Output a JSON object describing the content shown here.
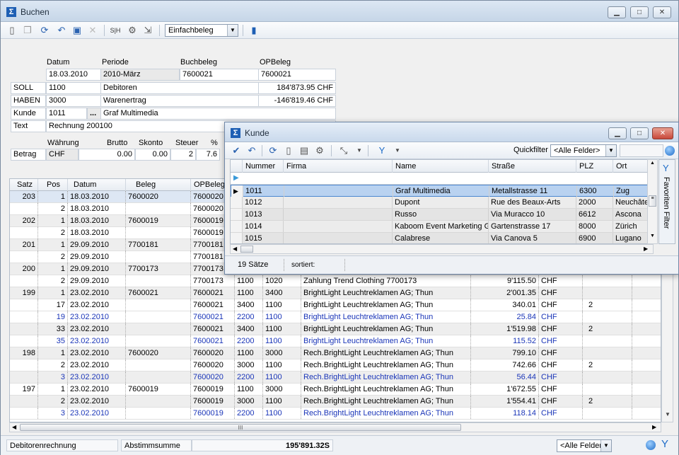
{
  "window": {
    "title": "Buchen"
  },
  "toolbar": {
    "mode_select": "Einfachbeleg"
  },
  "form": {
    "headers": {
      "datum": "Datum",
      "periode": "Periode",
      "buchbeleg": "Buchbeleg",
      "opbeleg": "OPBeleg"
    },
    "datum": "18.03.2010",
    "periode": "2010-März",
    "buchbeleg": "7600021",
    "opbeleg": "7600021",
    "soll": {
      "label": "SOLL",
      "konto": "1100",
      "name": "Debitoren",
      "saldo": "184'873.95 CHF"
    },
    "haben": {
      "label": "HABEN",
      "konto": "3000",
      "name": "Warenertrag",
      "saldo": "-146'819.46 CHF"
    },
    "kunde": {
      "label": "Kunde",
      "nummer": "1011",
      "browse": "...",
      "name": "Graf Multimedia"
    },
    "text": {
      "label": "Text",
      "value": "Rechnung 200100"
    },
    "betrag_headers": {
      "waehrung": "Währung",
      "brutto": "Brutto",
      "skonto": "Skonto",
      "steuer": "Steuer",
      "prozent": "%"
    },
    "betrag": {
      "label": "Betrag",
      "waehrung": "CHF",
      "brutto": "0.00",
      "skonto": "0.00",
      "steuer": "2",
      "prozent": "7.6"
    }
  },
  "journal": {
    "columns": [
      "Satz",
      "Pos",
      "Datum",
      "Beleg",
      "OPBeleg"
    ],
    "rows": [
      {
        "satz": "203",
        "pos": "1",
        "datum": "18.03.2010",
        "beleg": "7600020",
        "opbeleg": "7600020",
        "soll": "",
        "haben": "",
        "text": "",
        "betrag": "",
        "waehrung": "",
        "steuer": "",
        "style": "sel"
      },
      {
        "satz": "",
        "pos": "2",
        "datum": "18.03.2010",
        "beleg": "",
        "opbeleg": "7600020",
        "soll": "",
        "haben": "",
        "text": "",
        "betrag": "",
        "waehrung": "",
        "steuer": "",
        "style": "white"
      },
      {
        "satz": "202",
        "pos": "1",
        "datum": "18.03.2010",
        "beleg": "7600019",
        "opbeleg": "7600019",
        "soll": "",
        "haben": "",
        "text": "",
        "betrag": "",
        "waehrung": "",
        "steuer": "",
        "style": "alt"
      },
      {
        "satz": "",
        "pos": "2",
        "datum": "18.03.2010",
        "beleg": "",
        "opbeleg": "7600019",
        "soll": "",
        "haben": "",
        "text": "",
        "betrag": "",
        "waehrung": "",
        "steuer": "",
        "style": "white"
      },
      {
        "satz": "201",
        "pos": "1",
        "datum": "29.09.2010",
        "beleg": "7700181",
        "opbeleg": "7700181",
        "soll": "",
        "haben": "",
        "text": "",
        "betrag": "",
        "waehrung": "",
        "steuer": "",
        "style": "alt"
      },
      {
        "satz": "",
        "pos": "2",
        "datum": "29.09.2010",
        "beleg": "",
        "opbeleg": "7700181",
        "soll": "",
        "haben": "",
        "text": "",
        "betrag": "",
        "waehrung": "",
        "steuer": "",
        "style": "white"
      },
      {
        "satz": "200",
        "pos": "1",
        "datum": "29.09.2010",
        "beleg": "7700173",
        "opbeleg": "7700173",
        "soll": "",
        "haben": "",
        "text": "",
        "betrag": "",
        "waehrung": "",
        "steuer": "",
        "style": "alt"
      },
      {
        "satz": "",
        "pos": "2",
        "datum": "29.09.2010",
        "beleg": "",
        "opbeleg": "7700173",
        "soll": "1100",
        "haben": "1020",
        "text": "Zahlung Trend Clothing 7700173",
        "betrag": "9'115.50",
        "waehrung": "CHF",
        "steuer": "",
        "style": "white"
      },
      {
        "satz": "199",
        "pos": "1",
        "datum": "23.02.2010",
        "beleg": "7600021",
        "opbeleg": "7600021",
        "soll": "1100",
        "haben": "3400",
        "text": "BrightLight Leuchtreklamen AG; Thun",
        "betrag": "2'001.35",
        "waehrung": "CHF",
        "steuer": "",
        "style": "alt"
      },
      {
        "satz": "",
        "pos": "17",
        "datum": "23.02.2010",
        "beleg": "",
        "opbeleg": "7600021",
        "soll": "3400",
        "haben": "1100",
        "text": "BrightLight Leuchtreklamen AG; Thun",
        "betrag": "340.01",
        "waehrung": "CHF",
        "steuer": "2",
        "style": "white"
      },
      {
        "satz": "",
        "pos": "19",
        "datum": "23.02.2010",
        "beleg": "",
        "opbeleg": "7600021",
        "soll": "2200",
        "haben": "1100",
        "text": "BrightLight Leuchtreklamen AG; Thun",
        "betrag": "25.84",
        "waehrung": "CHF",
        "steuer": "",
        "style": "white blue"
      },
      {
        "satz": "",
        "pos": "33",
        "datum": "23.02.2010",
        "beleg": "",
        "opbeleg": "7600021",
        "soll": "3400",
        "haben": "1100",
        "text": "BrightLight Leuchtreklamen AG; Thun",
        "betrag": "1'519.98",
        "waehrung": "CHF",
        "steuer": "2",
        "style": "alt"
      },
      {
        "satz": "",
        "pos": "35",
        "datum": "23.02.2010",
        "beleg": "",
        "opbeleg": "7600021",
        "soll": "2200",
        "haben": "1100",
        "text": "BrightLight Leuchtreklamen AG; Thun",
        "betrag": "115.52",
        "waehrung": "CHF",
        "steuer": "",
        "style": "white blue"
      },
      {
        "satz": "198",
        "pos": "1",
        "datum": "23.02.2010",
        "beleg": "7600020",
        "opbeleg": "7600020",
        "soll": "1100",
        "haben": "3000",
        "text": "Rech.BrightLight Leuchtreklamen AG; Thun",
        "betrag": "799.10",
        "waehrung": "CHF",
        "steuer": "",
        "style": "alt"
      },
      {
        "satz": "",
        "pos": "2",
        "datum": "23.02.2010",
        "beleg": "",
        "opbeleg": "7600020",
        "soll": "3000",
        "haben": "1100",
        "text": "Rech.BrightLight Leuchtreklamen AG; Thun",
        "betrag": "742.66",
        "waehrung": "CHF",
        "steuer": "2",
        "style": "white"
      },
      {
        "satz": "",
        "pos": "3",
        "datum": "23.02.2010",
        "beleg": "",
        "opbeleg": "7600020",
        "soll": "2200",
        "haben": "1100",
        "text": "Rech.BrightLight Leuchtreklamen AG; Thun",
        "betrag": "56.44",
        "waehrung": "CHF",
        "steuer": "",
        "style": "alt blue"
      },
      {
        "satz": "197",
        "pos": "1",
        "datum": "23.02.2010",
        "beleg": "7600019",
        "opbeleg": "7600019",
        "soll": "1100",
        "haben": "3000",
        "text": "Rech.BrightLight Leuchtreklamen AG; Thun",
        "betrag": "1'672.55",
        "waehrung": "CHF",
        "steuer": "",
        "style": "white"
      },
      {
        "satz": "",
        "pos": "2",
        "datum": "23.02.2010",
        "beleg": "",
        "opbeleg": "7600019",
        "soll": "3000",
        "haben": "1100",
        "text": "Rech.BrightLight Leuchtreklamen AG; Thun",
        "betrag": "1'554.41",
        "waehrung": "CHF",
        "steuer": "2",
        "style": "alt"
      },
      {
        "satz": "",
        "pos": "3",
        "datum": "23.02.2010",
        "beleg": "",
        "opbeleg": "7600019",
        "soll": "2200",
        "haben": "1100",
        "text": "Rech.BrightLight Leuchtreklamen AG; Thun",
        "betrag": "118.14",
        "waehrung": "CHF",
        "steuer": "",
        "style": "white blue"
      }
    ],
    "hscroll_label": "III"
  },
  "statusbar": {
    "left": "Debitorenrechnung",
    "abstimm_label": "Abstimmsumme",
    "abstimm_value": "195'891.32S",
    "filter": "<Alle Felder>"
  },
  "kunde": {
    "title": "Kunde",
    "quickfilter_label": "Quickfilter",
    "quickfilter_value": "<Alle Felder>",
    "columns": [
      "Nummer",
      "Firma",
      "Name",
      "Straße",
      "PLZ",
      "Ort"
    ],
    "rows": [
      {
        "nummer": "1011",
        "firma": "",
        "name": "Graf Multimedia",
        "strasse": "Metallstrasse 11",
        "plz": "6300",
        "ort": "Zug"
      },
      {
        "nummer": "1012",
        "firma": "",
        "name": "Dupont",
        "strasse": "Rue des Beaux-Arts",
        "plz": "2000",
        "ort": "Neuchâtel"
      },
      {
        "nummer": "1013",
        "firma": "",
        "name": "Russo",
        "strasse": "Via Muracco 10",
        "plz": "6612",
        "ort": "Ascona"
      },
      {
        "nummer": "1014",
        "firma": "",
        "name": "Kaboom Event Marketing GmbH",
        "strasse": "Gartenstrasse 17",
        "plz": "8000",
        "ort": "Zürich"
      },
      {
        "nummer": "1015",
        "firma": "",
        "name": "Calabrese",
        "strasse": "Via Canova 5",
        "plz": "6900",
        "ort": "Lugano"
      }
    ],
    "side_tab": "Favoriten Filter",
    "status_count": "19 Sätze",
    "status_sort": "sortiert:"
  }
}
